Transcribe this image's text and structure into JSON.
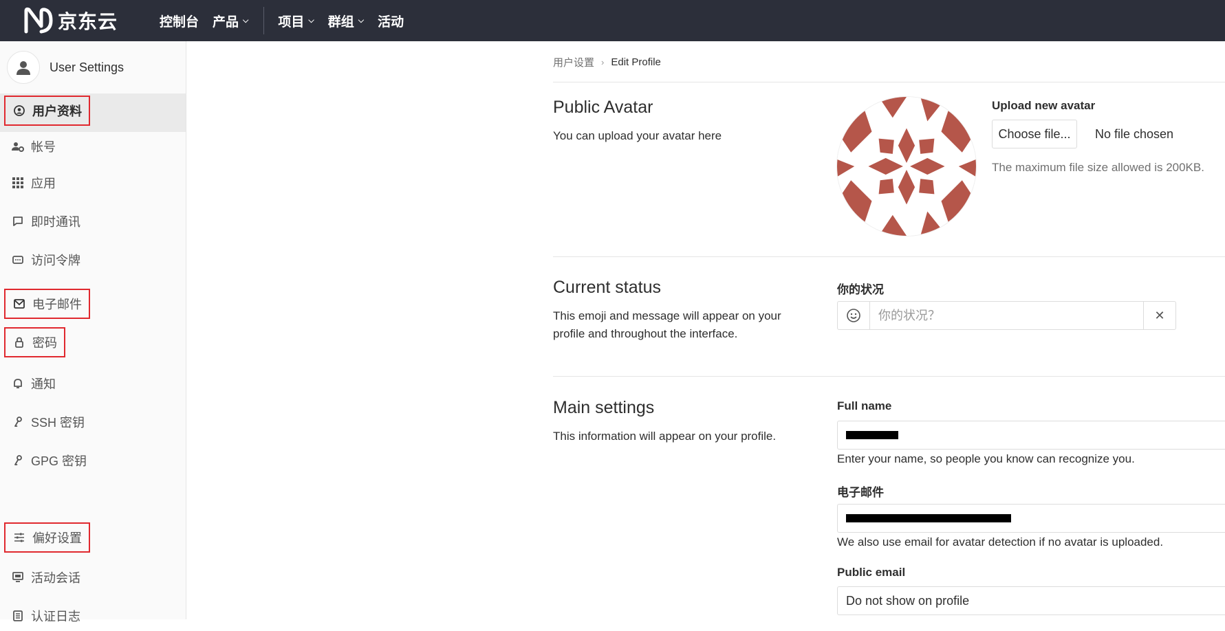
{
  "brand": {
    "name": "京东云"
  },
  "nav": {
    "items": [
      {
        "label": "控制台",
        "dropdown": false
      },
      {
        "label": "产品",
        "dropdown": true
      },
      {
        "label": "项目",
        "dropdown": true
      },
      {
        "label": "群组",
        "dropdown": true
      },
      {
        "label": "活动",
        "dropdown": false
      }
    ]
  },
  "sidebar": {
    "title": "User Settings",
    "items": [
      {
        "label": "用户资料",
        "icon": "user-circle-icon"
      },
      {
        "label": "帐号",
        "icon": "user-gear-icon"
      },
      {
        "label": "应用",
        "icon": "apps-grid-icon"
      },
      {
        "label": "即时通讯",
        "icon": "chat-icon"
      },
      {
        "label": "访问令牌",
        "icon": "token-icon"
      },
      {
        "label": "电子邮件",
        "icon": "mail-icon"
      },
      {
        "label": "密码",
        "icon": "lock-icon"
      },
      {
        "label": "通知",
        "icon": "bell-icon"
      },
      {
        "label": "SSH 密钥",
        "icon": "key-icon"
      },
      {
        "label": "GPG 密钥",
        "icon": "key-icon"
      },
      {
        "label": "偏好设置",
        "icon": "sliders-icon"
      },
      {
        "label": "活动会话",
        "icon": "monitor-icon"
      },
      {
        "label": "认证日志",
        "icon": "log-icon"
      }
    ]
  },
  "breadcrumb": {
    "parent": "用户设置",
    "current": "Edit Profile"
  },
  "avatar": {
    "title": "Public Avatar",
    "description": "You can upload your avatar here",
    "upload_label": "Upload new avatar",
    "choose_button": "Choose file...",
    "file_status": "No file chosen",
    "max_size_hint": "The maximum file size allowed is 200KB.",
    "identicon_color": "#b5564a"
  },
  "status": {
    "title": "Current status",
    "description": "This emoji and message will appear on your profile and throughout the interface.",
    "label": "你的状况",
    "placeholder": "你的状况？",
    "clear_symbol": "✕"
  },
  "main_settings": {
    "title": "Main settings",
    "description": "This information will appear on your profile.",
    "full_name_label": "Full name",
    "full_name_help": "Enter your name, so people you know can recognize you.",
    "email_label": "电子邮件",
    "email_help": "We also use email for avatar detection if no avatar is uploaded.",
    "public_email_label": "Public email",
    "public_email_value": "Do not show on profile"
  },
  "colors": {
    "topbar": "#2c2f3a",
    "highlight_box": "#e0282e"
  }
}
